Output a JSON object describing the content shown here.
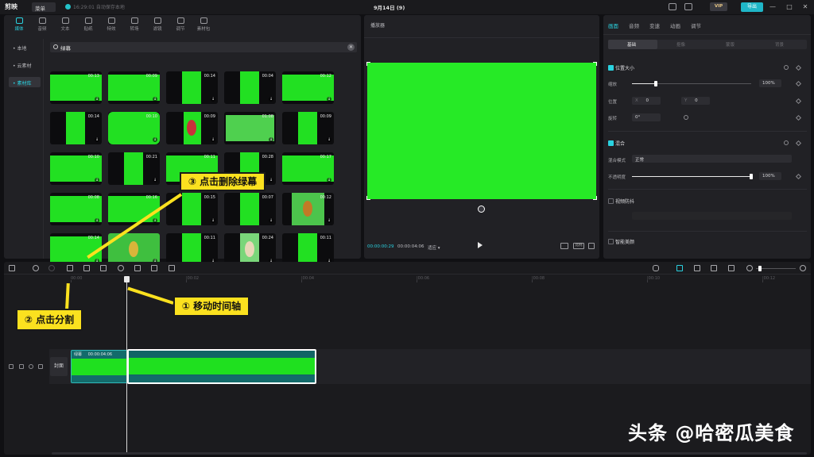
{
  "app": {
    "logo_text": "剪映",
    "menu_label": "菜单",
    "autosave_text": "16:29:01 自动保存本地",
    "project_title": "9月14日 (9)",
    "vip_label": "VIP",
    "export_label": "导出",
    "window_controls": [
      "—",
      "□",
      "✕"
    ]
  },
  "media": {
    "top_tabs": [
      {
        "label": "媒体",
        "icon": "media-icon",
        "active": true
      },
      {
        "label": "音频",
        "icon": "audio-icon"
      },
      {
        "label": "文本",
        "icon": "text-icon"
      },
      {
        "label": "贴纸",
        "icon": "sticker-icon"
      },
      {
        "label": "特效",
        "icon": "effects-icon"
      },
      {
        "label": "转场",
        "icon": "transition-icon"
      },
      {
        "label": "滤镜",
        "icon": "filter-icon"
      },
      {
        "label": "调节",
        "icon": "adjust-icon"
      },
      {
        "label": "素材包",
        "icon": "package-icon"
      }
    ],
    "side_items": [
      {
        "label": "• 本地"
      },
      {
        "label": "• 云素材"
      },
      {
        "label": "• 素材库",
        "active": true
      }
    ],
    "search_value": "绿幕",
    "thumbs": [
      {
        "dur": "00:13",
        "style": "full"
      },
      {
        "dur": "00:09",
        "style": "full"
      },
      {
        "dur": "00:14",
        "style": "portrait"
      },
      {
        "dur": "00:04",
        "style": "portrait"
      },
      {
        "dur": "00:12",
        "style": "full"
      },
      {
        "dur": "00:14",
        "style": "portrait"
      },
      {
        "dur": "00:10",
        "style": "rounded"
      },
      {
        "dur": "00:09",
        "style": "figure"
      },
      {
        "dur": "01:08",
        "style": "inset"
      },
      {
        "dur": "00:09",
        "style": "portrait"
      },
      {
        "dur": "00:10",
        "style": "full"
      },
      {
        "dur": "00:21",
        "style": "portrait"
      },
      {
        "dur": "00:11",
        "style": "full"
      },
      {
        "dur": "00:28",
        "style": "portrait"
      },
      {
        "dur": "00:17",
        "style": "full"
      },
      {
        "dur": "00:08",
        "style": "full"
      },
      {
        "dur": "00:16",
        "style": "full"
      },
      {
        "dur": "00:15",
        "style": "portrait"
      },
      {
        "dur": "00:07",
        "style": "portrait"
      },
      {
        "dur": "00:12",
        "style": "butterfly"
      },
      {
        "dur": "00:14",
        "style": "full"
      },
      {
        "dur": "",
        "style": "dragon"
      },
      {
        "dur": "00:11",
        "style": "portrait"
      },
      {
        "dur": "00:24",
        "style": "girl"
      },
      {
        "dur": "00:11",
        "style": "portrait"
      }
    ]
  },
  "player": {
    "title": "播放器",
    "current_time": "00:00:00:29",
    "total_time": "00:00:04:06",
    "mode_label": "适应 ▾",
    "ratio_label": "比例"
  },
  "inspector": {
    "tabs": [
      {
        "label": "画面",
        "active": true
      },
      {
        "label": "音频"
      },
      {
        "label": "变速"
      },
      {
        "label": "动画"
      },
      {
        "label": "调节"
      }
    ],
    "subtabs": [
      {
        "label": "基础",
        "active": true
      },
      {
        "label": "抠像"
      },
      {
        "label": "蒙版"
      },
      {
        "label": "背景"
      }
    ],
    "position_size_title": "位置大小",
    "scale_label": "缩放",
    "scale_value": "100%",
    "scale_fraction": 0.2,
    "position_label": "位置",
    "pos_x_axis": "X",
    "pos_x": "0",
    "pos_y_axis": "Y",
    "pos_y": "0",
    "rotate_label": "旋转",
    "rotate_value": "0°",
    "blend_title": "混合",
    "blend_mode_label": "混合模式",
    "blend_mode_value": "正常",
    "opacity_label": "不透明度",
    "opacity_value": "100%",
    "opacity_fraction": 1.0,
    "stabilize_title": "视频防抖",
    "smart_beauty_title": "智能美颜"
  },
  "timeline": {
    "ruler": [
      "00:00",
      "|00:02",
      "|00:04",
      "|00:06",
      "|00:08",
      "|00:10",
      "|00:12"
    ],
    "cover_label": "封面",
    "clip_a_label": "绿幕",
    "clip_a_duration": "00:00:04:06"
  },
  "callouts": {
    "move_playhead": "① 移动时间轴",
    "click_split": "② 点击分割",
    "click_delete": "③ 点击删除绿幕"
  },
  "watermark": "头条 @哈密瓜美食",
  "colors": {
    "accent": "#2ad2e0",
    "chroma_green": "#22e022",
    "callout_yellow": "#fbe11f",
    "export_button": "#1fb6c8"
  }
}
